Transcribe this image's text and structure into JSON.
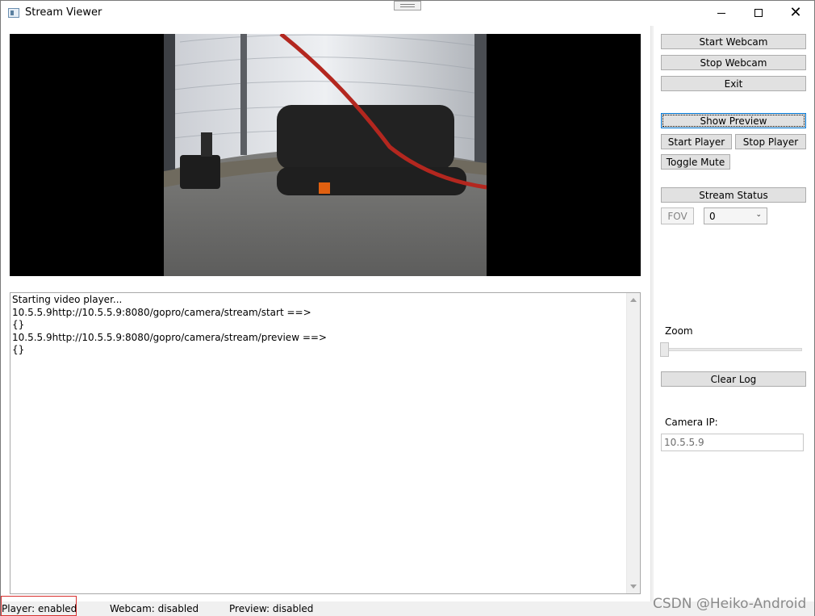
{
  "window": {
    "title": "Stream Viewer"
  },
  "log": {
    "lines": [
      "Starting video player...",
      "10.5.5.9http://10.5.5.9:8080/gopro/camera/stream/start ==>",
      "{}",
      "10.5.5.9http://10.5.5.9:8080/gopro/camera/stream/preview ==>",
      "{}"
    ]
  },
  "controls": {
    "start_webcam": "Start Webcam",
    "stop_webcam": "Stop Webcam",
    "exit": "Exit",
    "show_preview": "Show Preview",
    "start_player": "Start Player",
    "stop_player": "Stop Player",
    "toggle_mute": "Toggle Mute",
    "stream_status": "Stream Status",
    "fov": "FOV",
    "fov_value": "0",
    "zoom_label": "Zoom",
    "zoom_value": 0,
    "clear_log": "Clear Log",
    "camera_ip_label": "Camera IP:",
    "camera_ip_value": "10.5.5.9"
  },
  "status": {
    "player": "Player: enabled",
    "webcam": "Webcam: disabled",
    "preview": "Preview: disabled"
  },
  "watermark": "CSDN @Heiko-Android"
}
